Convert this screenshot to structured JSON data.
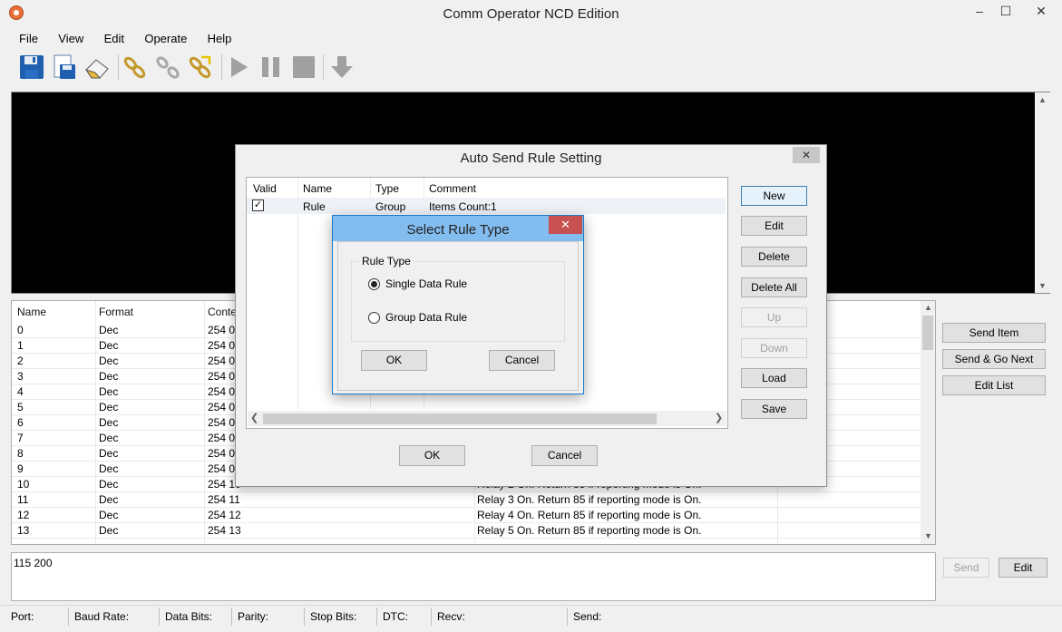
{
  "window": {
    "title": "Comm Operator NCD Edition",
    "minimize": "–",
    "maximize": "☐",
    "close": "✕"
  },
  "menu": [
    "File",
    "View",
    "Edit",
    "Operate",
    "Help"
  ],
  "toolbar_icons": [
    "save-icon",
    "save-as-icon",
    "eraser-icon",
    "connect-icon",
    "disconnect-icon",
    "reconnect-icon",
    "play-icon",
    "pause-icon",
    "stop-icon",
    "download-icon"
  ],
  "list": {
    "headers": [
      "Name",
      "Format",
      "Content"
    ],
    "rows": [
      {
        "name": "0",
        "format": "Dec",
        "content": "254 00",
        "comment": ""
      },
      {
        "name": "1",
        "format": "Dec",
        "content": "254 01",
        "comment": ""
      },
      {
        "name": "2",
        "format": "Dec",
        "content": "254 02",
        "comment": ""
      },
      {
        "name": "3",
        "format": "Dec",
        "content": "254 03",
        "comment": ""
      },
      {
        "name": "4",
        "format": "Dec",
        "content": "254 04",
        "comment": ""
      },
      {
        "name": "5",
        "format": "Dec",
        "content": "254 05",
        "comment": ""
      },
      {
        "name": "6",
        "format": "Dec",
        "content": "254 06",
        "comment": ""
      },
      {
        "name": "7",
        "format": "Dec",
        "content": "254 07",
        "comment": ""
      },
      {
        "name": "8",
        "format": "Dec",
        "content": "254 08",
        "comment": ""
      },
      {
        "name": "9",
        "format": "Dec",
        "content": "254 09",
        "comment": ""
      },
      {
        "name": "10",
        "format": "Dec",
        "content": "254 10",
        "comment": "Relay 2 On. Return 85 if reporting mode is On."
      },
      {
        "name": "11",
        "format": "Dec",
        "content": "254 11",
        "comment": "Relay 3 On. Return 85 if reporting mode is On."
      },
      {
        "name": "12",
        "format": "Dec",
        "content": "254 12",
        "comment": "Relay 4 On. Return 85 if reporting mode is On."
      },
      {
        "name": "13",
        "format": "Dec",
        "content": "254 13",
        "comment": "Relay 5 On. Return 85 if reporting mode is On."
      }
    ]
  },
  "side_buttons": {
    "send_item": "Send Item",
    "send_go_next": "Send & Go Next",
    "edit_list": "Edit List"
  },
  "send": {
    "value": "115 200",
    "send_label": "Send",
    "edit_label": "Edit"
  },
  "status": [
    "Port:",
    "Baud Rate:",
    "Data Bits:",
    "Parity:",
    "Stop Bits:",
    "DTC:",
    "Recv:",
    "Send:"
  ],
  "auto_send_dialog": {
    "title": "Auto Send Rule Setting",
    "close": "✕",
    "headers": [
      "Valid",
      "Name",
      "Type",
      "Comment"
    ],
    "row": {
      "valid": true,
      "name": "Rule",
      "type": "Group",
      "comment": "Items Count:1"
    },
    "buttons": [
      "New",
      "Edit",
      "Delete",
      "Delete All",
      "Up",
      "Down",
      "Load",
      "Save"
    ],
    "ok": "OK",
    "cancel": "Cancel"
  },
  "rule_type_dialog": {
    "title": "Select Rule Type",
    "close": "✕",
    "group_label": "Rule Type",
    "options": [
      "Single Data Rule",
      "Group Data Rule"
    ],
    "selected": 0,
    "ok": "OK",
    "cancel": "Cancel"
  }
}
